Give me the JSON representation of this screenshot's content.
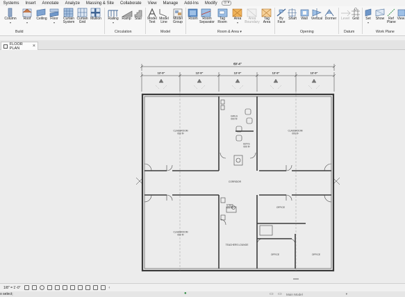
{
  "menu": {
    "items": [
      "Systems",
      "Insert",
      "Annotate",
      "Analyze",
      "Massing & Site",
      "Collaborate",
      "View",
      "Manage",
      "Add-Ins",
      "Modify"
    ]
  },
  "ribbon": {
    "build": {
      "label": "Build",
      "buttons": [
        {
          "label": "Column",
          "dropdown": true,
          "icon": "column-icon"
        },
        {
          "label": "Roof",
          "dropdown": true,
          "icon": "roof-icon"
        },
        {
          "label": "Ceiling",
          "dropdown": false,
          "icon": "ceiling-icon"
        },
        {
          "label": "Floor",
          "dropdown": true,
          "icon": "floor-icon"
        },
        {
          "label": "Curtain System",
          "dropdown": false,
          "icon": "curtain-system-icon"
        },
        {
          "label": "Curtain Grid",
          "dropdown": false,
          "icon": "curtain-grid-icon"
        },
        {
          "label": "Mullion",
          "dropdown": false,
          "icon": "mullion-icon"
        }
      ]
    },
    "circulation": {
      "label": "Circulation",
      "buttons": [
        {
          "label": "Railing",
          "dropdown": true,
          "icon": "railing-icon"
        },
        {
          "label": "Ramp",
          "dropdown": false,
          "icon": "ramp-icon"
        },
        {
          "label": "Stair",
          "dropdown": false,
          "icon": "stair-icon"
        }
      ]
    },
    "model": {
      "label": "Model",
      "buttons": [
        {
          "label": "Model Text",
          "icon": "model-text-icon"
        },
        {
          "label": "Model Line",
          "icon": "model-line-icon"
        },
        {
          "label": "Model Group",
          "dropdown": true,
          "icon": "model-group-icon"
        }
      ]
    },
    "room_area": {
      "label": "Room & Area",
      "buttons": [
        {
          "label": "Room",
          "icon": "room-icon"
        },
        {
          "label": "Room Separator",
          "icon": "room-separator-icon"
        },
        {
          "label": "Tag Room",
          "dropdown": true,
          "icon": "tag-room-icon"
        },
        {
          "label": "Area",
          "dropdown": true,
          "icon": "area-icon"
        },
        {
          "label": "Area Boundary",
          "icon": "area-boundary-icon"
        },
        {
          "label": "Tag Area",
          "dropdown": true,
          "icon": "tag-area-icon"
        }
      ]
    },
    "opening": {
      "label": "Opening",
      "buttons": [
        {
          "label": "By Face",
          "icon": "by-face-icon"
        },
        {
          "label": "Shaft",
          "icon": "shaft-icon"
        },
        {
          "label": "Wall",
          "icon": "wall-opening-icon"
        },
        {
          "label": "Vertical",
          "icon": "vertical-icon"
        },
        {
          "label": "Dormer",
          "icon": "dormer-icon"
        }
      ]
    },
    "datum": {
      "label": "Datum",
      "buttons": [
        {
          "label": "Level",
          "icon": "level-icon"
        },
        {
          "label": "Grid",
          "icon": "grid-icon"
        }
      ]
    },
    "work_plane": {
      "label": "Work Plane",
      "buttons": [
        {
          "label": "Set",
          "icon": "set-icon"
        },
        {
          "label": "Show",
          "icon": "show-icon"
        },
        {
          "label": "Ref Plane",
          "icon": "ref-plane-icon"
        },
        {
          "label": "View",
          "icon": "viewer-icon"
        }
      ]
    }
  },
  "tab": {
    "label": "FLOOR PLAN"
  },
  "plan": {
    "overall_dimension": "69'-4\"",
    "bay_dimension": "13'-9\"",
    "rooms": [
      {
        "name": "CLASSROOM",
        "number": "000 ft²"
      },
      {
        "name": "CLASSROOM",
        "number": "000 ft²"
      },
      {
        "name": "CLASSROOM",
        "number": "000 ft²"
      },
      {
        "name": "GIRLS",
        "number": "000 ft²"
      },
      {
        "name": "BOYS",
        "number": "000 ft²"
      },
      {
        "name": "CORRIDOR",
        "number": ""
      },
      {
        "name": "STAFF",
        "number": "000 ft²"
      },
      {
        "name": "OFFICE",
        "number": ""
      },
      {
        "name": "TEACHERS LOUNGE",
        "number": ""
      },
      {
        "name": "OFFICE",
        "number": ""
      },
      {
        "name": "OFFICE",
        "number": ""
      }
    ]
  },
  "viewbar": {
    "scale": "1/8\" = 1'-0\""
  },
  "status": {
    "text": "o select;",
    "model": "Main Model"
  },
  "colors": {
    "accent": "#2a6db0",
    "wall": "#3a3a3a",
    "canvas": "#ececec"
  }
}
